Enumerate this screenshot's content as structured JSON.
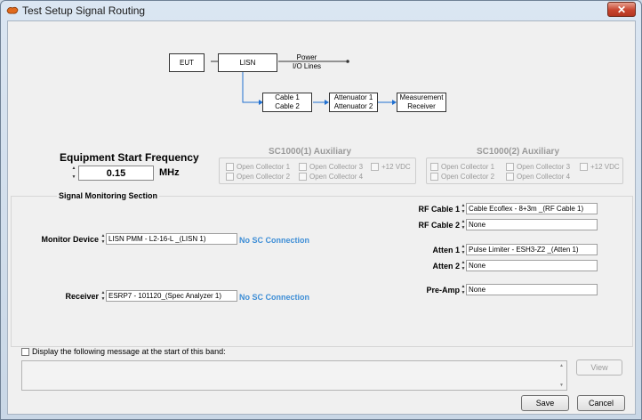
{
  "window": {
    "title": "Test Setup Signal Routing",
    "close_glyph": "✕"
  },
  "diagram": {
    "eut": "EUT",
    "lisn": "LISN",
    "power": "Power\nI/O Lines",
    "cable": "Cable 1\nCable 2",
    "attenuator": "Attenuator 1\nAttenuator 2",
    "receiver": "Measurement\nReceiver"
  },
  "equipment_start": {
    "label": "Equipment Start Frequency",
    "value": "0.15",
    "unit": "MHz"
  },
  "aux1": {
    "title": "SC1000(1) Auxiliary",
    "items": [
      "Open Collector 1",
      "Open Collector 3",
      "+12 VDC",
      "Open Collector 2",
      "Open Collector 4"
    ]
  },
  "aux2": {
    "title": "SC1000(2) Auxiliary",
    "items": [
      "Open Collector 1",
      "Open Collector 3",
      "+12 VDC",
      "Open Collector 2",
      "Open Collector 4"
    ]
  },
  "signal_monitoring": {
    "title": "Signal Monitoring Section",
    "monitor_device_label": "Monitor Device",
    "monitor_device_value": "LISN PMM - L2-16-L _(LISN 1)",
    "monitor_sc_status": "No SC Connection",
    "receiver_label": "Receiver",
    "receiver_value": "ESRP7 - 101120_(Spec Analyzer 1)",
    "receiver_sc_status": "No SC Connection",
    "rf_cable1_label": "RF Cable 1",
    "rf_cable1_value": "Cable Ecoflex - 8+3m _(RF Cable 1)",
    "rf_cable2_label": "RF Cable 2",
    "rf_cable2_value": "None",
    "atten1_label": "Atten 1",
    "atten1_value": "Pulse Limiter - ESH3-Z2 _(Atten 1)",
    "atten2_label": "Atten 2",
    "atten2_value": "None",
    "preamp_label": "Pre-Amp",
    "preamp_value": "None"
  },
  "message": {
    "checkbox_label": "Display the following message at the start of this band:",
    "text": ""
  },
  "buttons": {
    "view": "View",
    "save": "Save",
    "cancel": "Cancel"
  },
  "icons": {
    "app": "app-icon",
    "spin": "spin-arrows-icon"
  }
}
